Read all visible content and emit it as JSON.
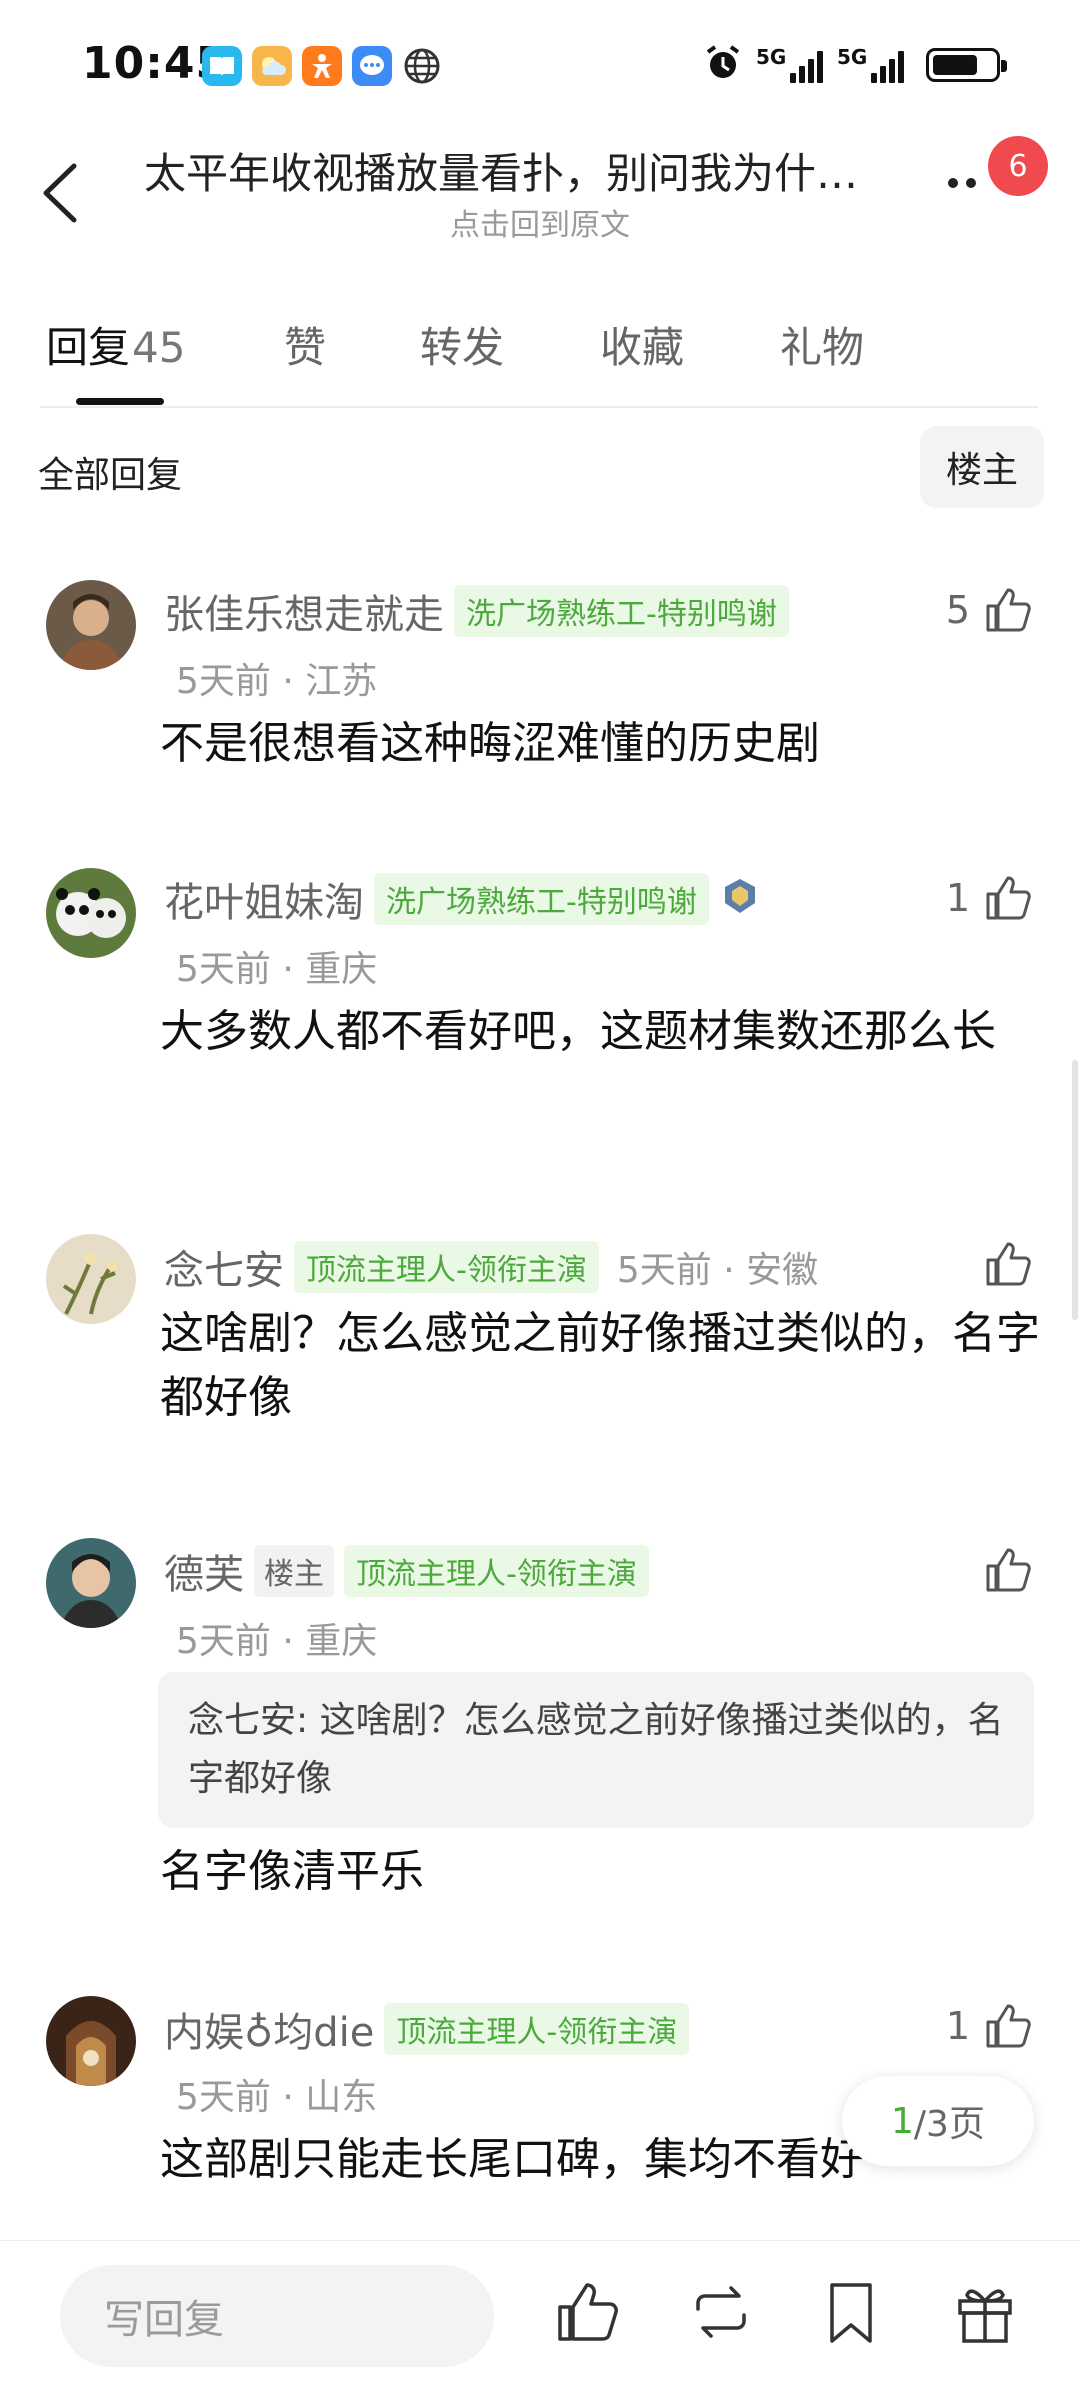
{
  "status": {
    "time": "10:45",
    "sim1": "5G",
    "sim2": "5G"
  },
  "header": {
    "title": "太平年收视播放量看扑，别问我为什…",
    "subtitle": "点击回到原文",
    "badge": "6"
  },
  "tabs": [
    {
      "label": "回复",
      "count": "45"
    },
    {
      "label": "赞"
    },
    {
      "label": "转发"
    },
    {
      "label": "收藏"
    },
    {
      "label": "礼物"
    }
  ],
  "filter": {
    "label": "全部回复",
    "owner_button": "楼主"
  },
  "comments": [
    {
      "name": "张佳乐想走就走",
      "tag": "洗广场熟练工-特别鸣谢",
      "time": "5天前",
      "dot": "·",
      "loc": "江苏",
      "text": "不是很想看这种晦涩难懂的历史剧",
      "likes": "5"
    },
    {
      "name": "花叶姐妹淘",
      "tag": "洗广场熟练工-特别鸣谢",
      "time": "5天前",
      "dot": "·",
      "loc": "重庆",
      "text": "大多数人都不看好吧，这题材集数还那么长",
      "likes": "1"
    },
    {
      "name": "念七安",
      "tag": "顶流主理人-领衔主演",
      "time": "5天前",
      "dot": "·",
      "loc": "安徽",
      "text": "这啥剧？怎么感觉之前好像播过类似的，名字都好像",
      "likes": ""
    },
    {
      "name": "德芙",
      "owner_tag": "楼主",
      "tag": "顶流主理人-领衔主演",
      "time": "5天前",
      "dot": "·",
      "loc": "重庆",
      "quote": "念七安: 这啥剧？怎么感觉之前好像播过类似的，名字都好像",
      "text": "名字像清平乐",
      "likes": ""
    },
    {
      "name": "内娱♁均die",
      "tag": "顶流主理人-领衔主演",
      "time": "5天前",
      "dot": "·",
      "loc": "山东",
      "text": "这部剧只能走长尾口碑，集均不看好",
      "likes": "1"
    }
  ],
  "pager": {
    "current": "1",
    "total": "/3页"
  },
  "bottom": {
    "reply_placeholder": "写回复"
  },
  "colors": {
    "accent_green": "#4caa3c",
    "badge_red": "#f0494e"
  }
}
